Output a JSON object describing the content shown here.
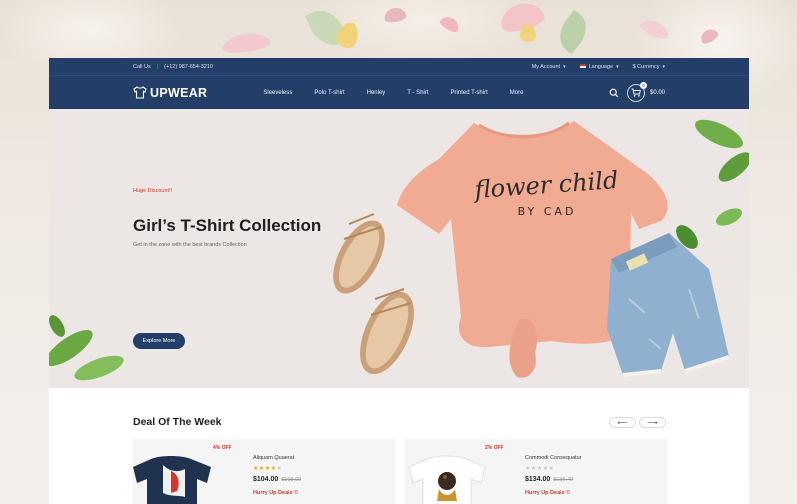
{
  "topbar": {
    "call_label": "Call Us",
    "phone": "(+12) 987-654-3210",
    "account": "My Account",
    "language": "Language",
    "currency": "$ Currency"
  },
  "navbar": {
    "logo": "UPWEAR",
    "menu": [
      "Sleeveless",
      "Polo T-shirt",
      "Henley",
      "T - Shirt",
      "Printed T-shirt",
      "More"
    ],
    "cart_count": "0",
    "cart_total": "$0.00",
    "search_icon": "search-icon",
    "cart_icon": "cart-icon"
  },
  "hero": {
    "badge": "Huge Discount!!",
    "title": "Girl’s T-Shirt Collection",
    "subtitle": "Get in the zone with the best brands Collection",
    "button": "Explore More",
    "shirt_print_line1": "flower child",
    "shirt_print_line2": "BY CAD"
  },
  "deals": {
    "title": "Deal Of The Week",
    "prev_icon": "arrow-left-icon",
    "next_icon": "arrow-right-icon",
    "prev_glyph": "⟵",
    "next_glyph": "⟶",
    "products": [
      {
        "discount": "4% OFF",
        "name": "Aliquam Quaerat",
        "rating": 4,
        "price": "$104.00",
        "old_price": "$108.00",
        "hurry": "Hurry Up Deals !!"
      },
      {
        "discount": "2% OFF",
        "name": "Commodi Consequatur",
        "rating": 0,
        "price": "$134.00",
        "old_price": "$136.40",
        "hurry": "Hurry Up Deals !!"
      }
    ]
  },
  "colors": {
    "brand_navy": "#233f69",
    "accent_red": "#d7362c",
    "star_gold": "#f0a500"
  }
}
